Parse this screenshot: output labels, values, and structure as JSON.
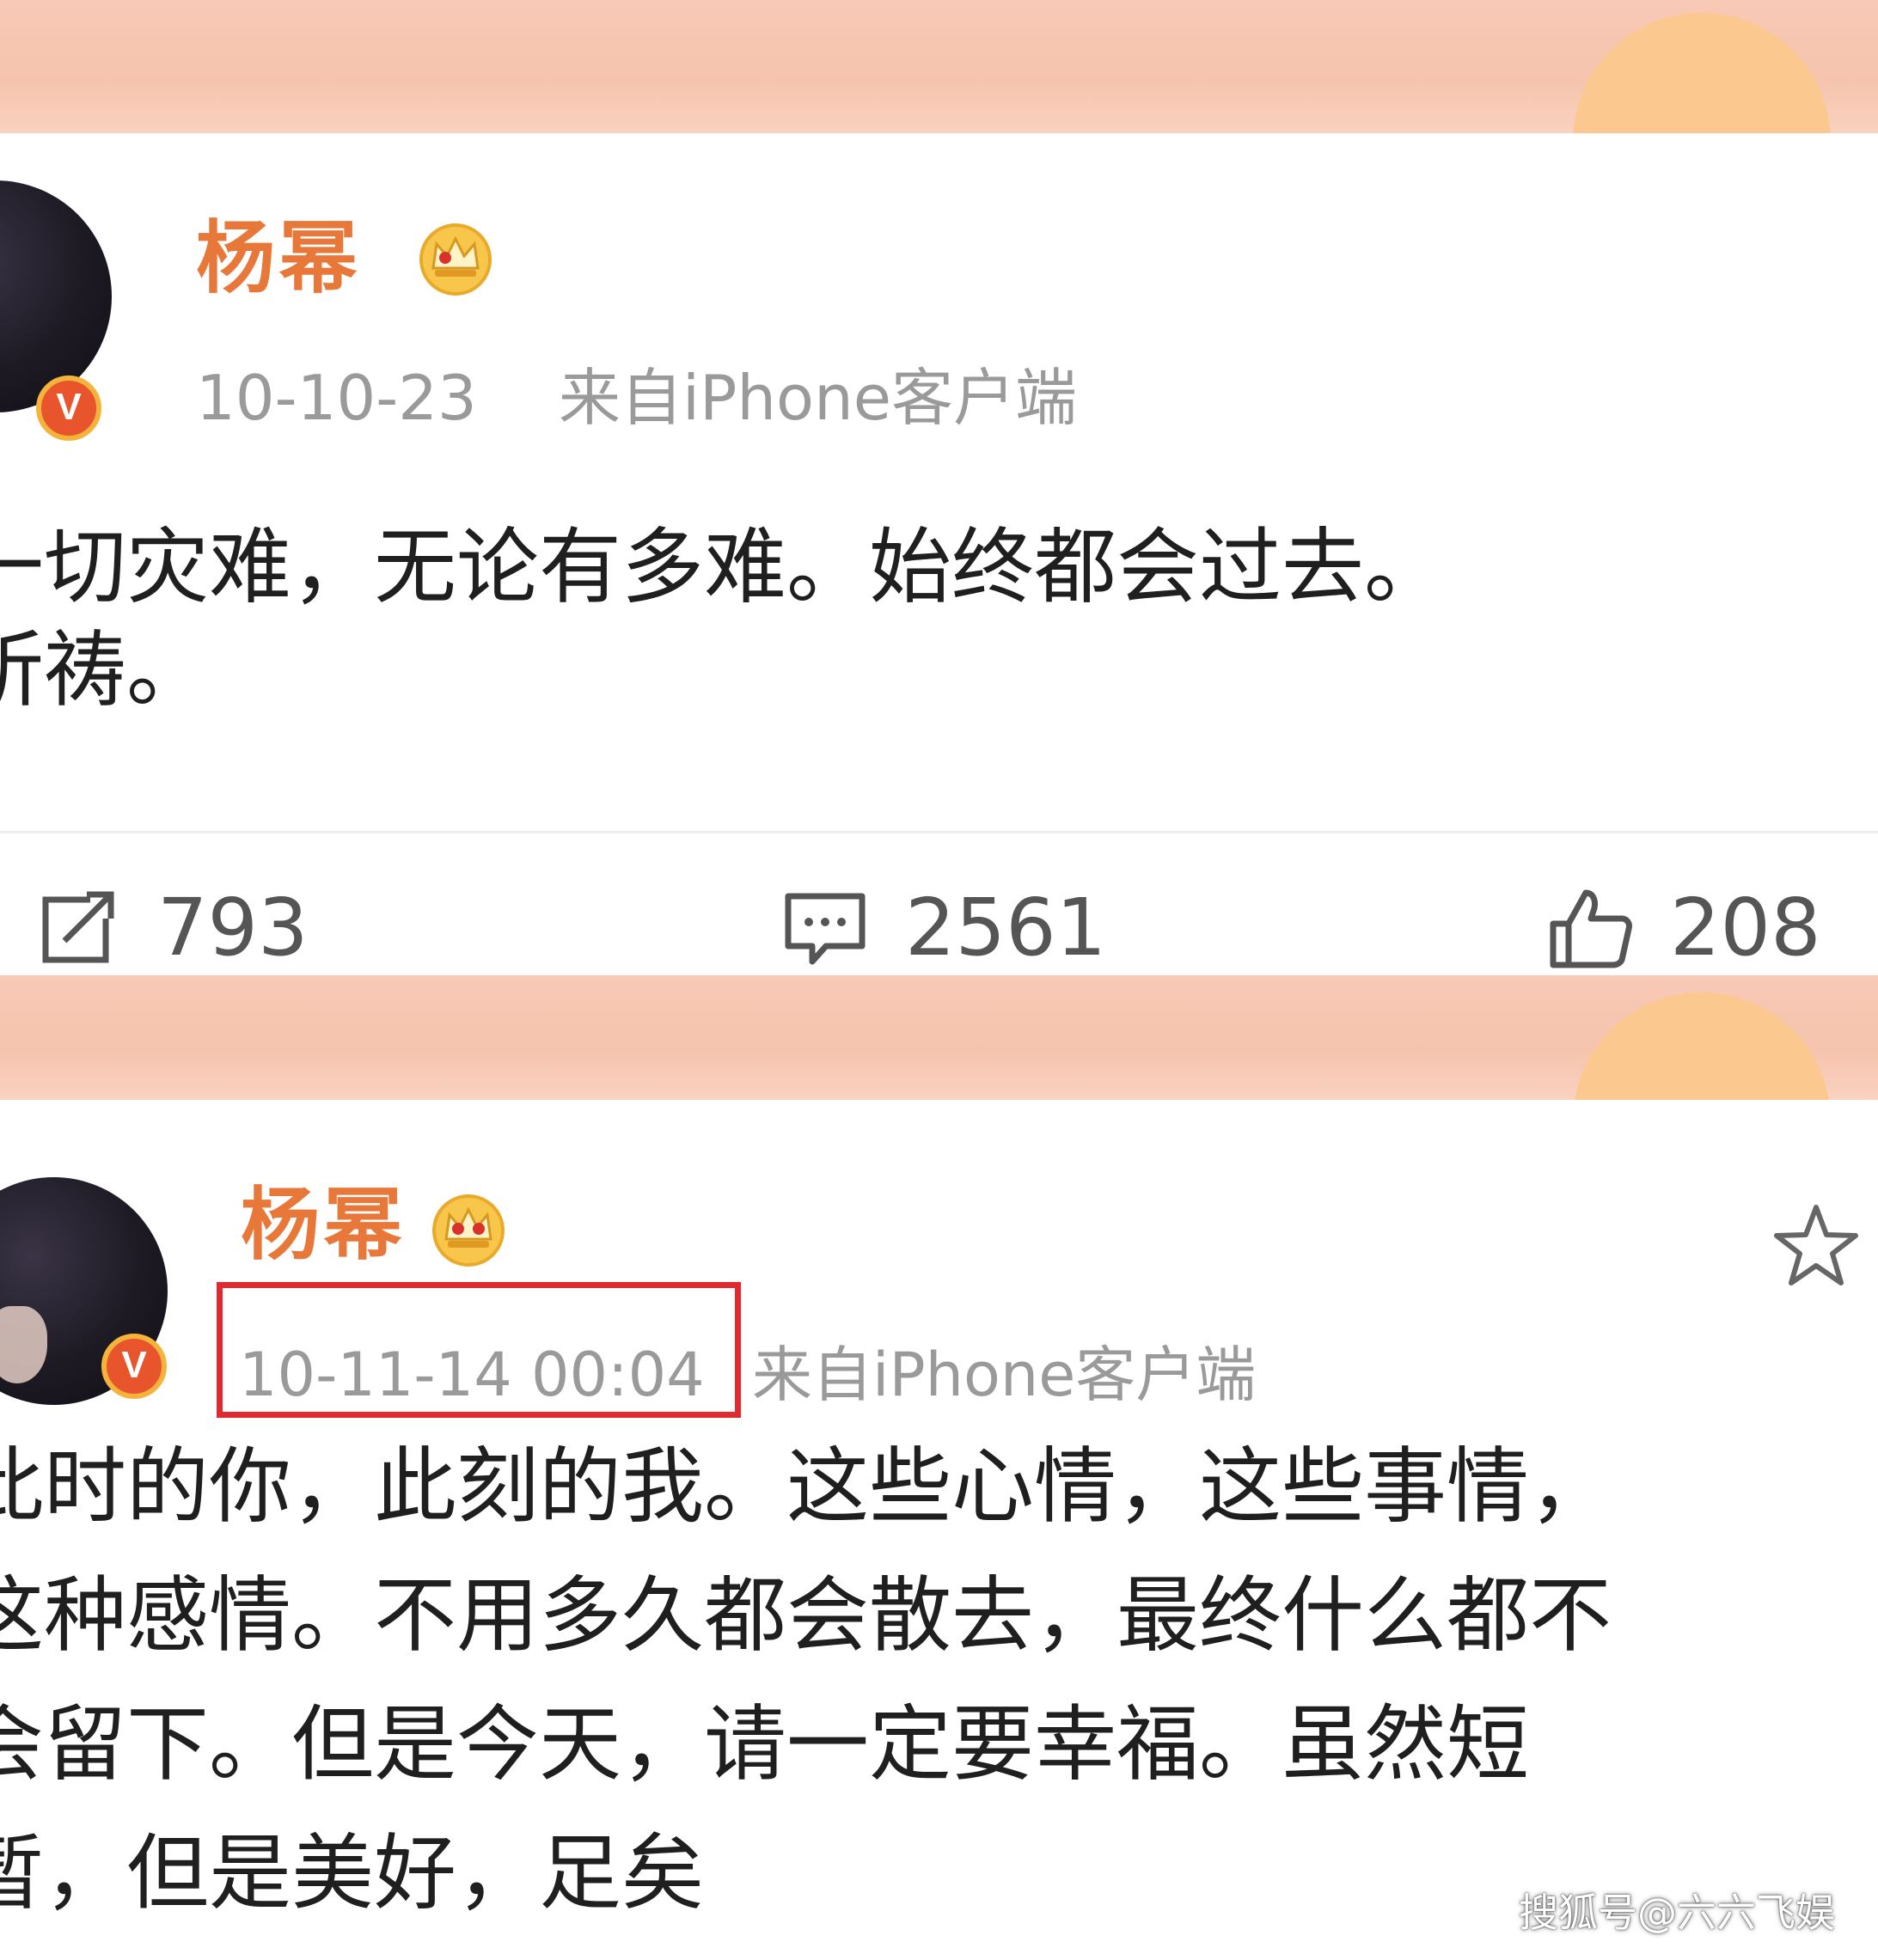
{
  "posts": [
    {
      "username": "杨幂",
      "time": "10-10-23",
      "source": "来自iPhone客户端",
      "text_lines": [
        "一切灾难，无论有多难。始终都会过去。",
        "祈祷。"
      ],
      "repost_count": "793",
      "comment_count": "2561",
      "like_count": "208"
    },
    {
      "username": "杨幂",
      "time": "10-11-14 00:04",
      "source": "来自iPhone客户端",
      "text_lines": [
        "此时的你，此刻的我。这些心情，这些事情，",
        "这种感情。不用多久都会散去，最终什么都不",
        "会留下。但是今天，请一定要幸福。虽然短",
        "暂，但是美好，足矣"
      ]
    }
  ],
  "verified_badge": "V",
  "watermark": "搜狐号@六六飞娱",
  "colors": {
    "username": "#e8773a",
    "highlight": "#e12a2f",
    "banner": "#f8c9b6",
    "meta": "#9a9a9a"
  },
  "icons": [
    "crown-icon",
    "verified-icon",
    "repost-icon",
    "comment-icon",
    "like-icon",
    "star-icon"
  ]
}
